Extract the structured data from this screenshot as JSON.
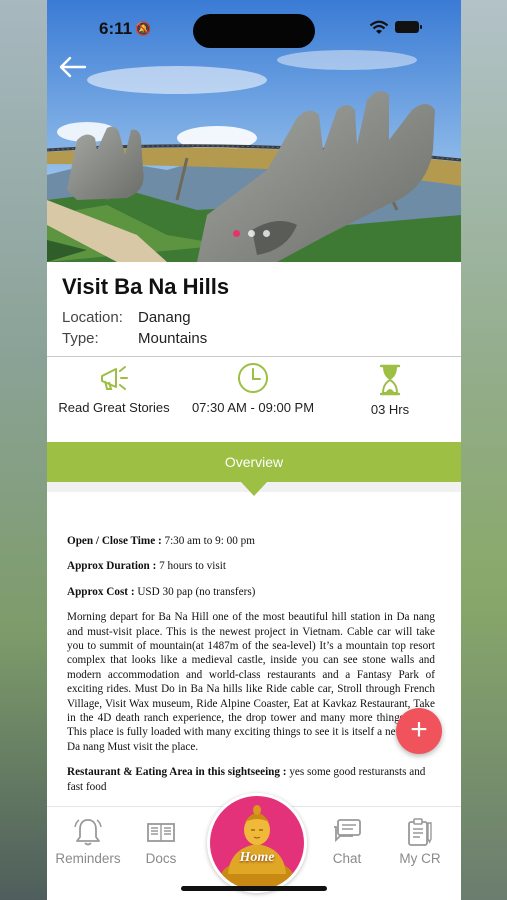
{
  "status_bar": {
    "time": "6:11"
  },
  "hero": {
    "slides": 3,
    "active_slide": 1,
    "back_icon": "arrow-left-icon"
  },
  "place": {
    "title": "Visit Ba Na Hills",
    "location_label": "Location:",
    "location_value": "Danang",
    "type_label": "Type:",
    "type_value": "Mountains"
  },
  "features": [
    {
      "icon": "megaphone-icon",
      "label": "Read Great Stories"
    },
    {
      "icon": "clock-icon",
      "label": "07:30 AM - 09:00 PM"
    },
    {
      "icon": "hourglass-icon",
      "label": "03 Hrs"
    }
  ],
  "overview": {
    "tab_label": "Overview",
    "open_close_label": "Open / Close Time :",
    "open_close_value": " 7:30 am to 9: 00 pm",
    "duration_label": "Approx Duration :",
    "duration_value": " 7 hours to visit",
    "cost_label": "Approx Cost :",
    "cost_value": " USD 30 pap (no transfers)",
    "description": "Morning depart for Ba Na Hill one of the most beautiful hill station in Da nang and must-visit place. This is the newest project in Vietnam. Cable car will take you to summit of mountain(at 1487m of the sea-level) It’s a mountain top resort complex that looks like a medieval castle, inside you can see stone walls and modern accommodation and world-class restaurants and a Fantasy Park of exciting rides. Must Do in Ba Na hills like Ride cable car, Stroll through French Village, Visit Wax museum, Ride Alpine Coaster, Eat at Kavkaz Restaurant, Take in the 4D death ranch experience, the drop tower and many more things to do. This place is fully loaded with many exciting things to see it is itself a new city in Da nang Must visit the place.",
    "restaurant_label": "Restaurant & Eating Area in this sightseeing :",
    "restaurant_value": " yes some good resturansts and fast food"
  },
  "fab": {
    "icon": "plus-icon"
  },
  "bottom_nav": {
    "reminders": "Reminders",
    "docs": "Docs",
    "home": "Home",
    "chat": "Chat",
    "my_cr": "My CR"
  },
  "colors": {
    "accent_green": "#9cbf44",
    "fab_red": "#f0535b",
    "home_pink": "#e3327a",
    "active_dot": "#e5336a"
  }
}
